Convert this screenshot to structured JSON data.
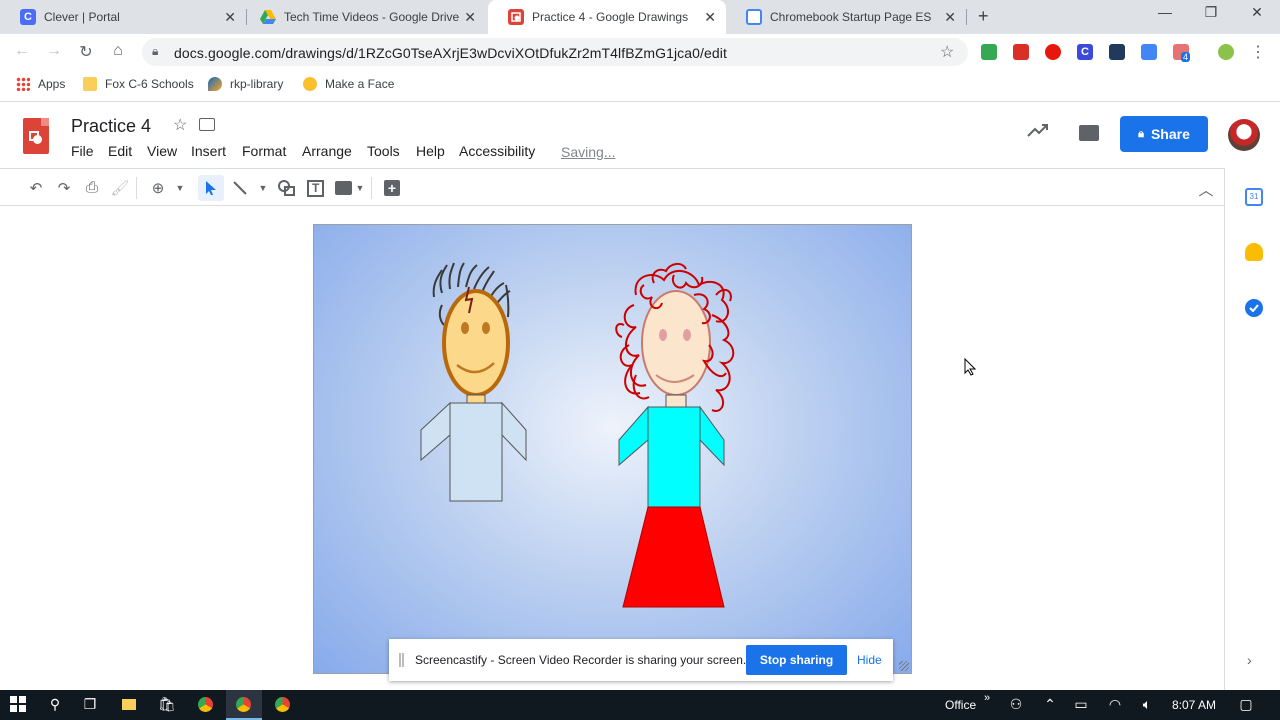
{
  "browser": {
    "tabs": [
      {
        "title": "Clever | Portal",
        "fav_color": "#4a6cf7",
        "fav_char": "C"
      },
      {
        "title": "Tech Time Videos - Google Drive",
        "fav_color": "#34a853",
        "fav_char": ""
      },
      {
        "title": "Practice 4 - Google Drawings",
        "fav_color": "#db4437",
        "fav_char": ""
      },
      {
        "title": "Chromebook Startup Page ES",
        "fav_color": "#4285f4",
        "fav_char": ""
      }
    ],
    "new_tab": "+",
    "url": "docs.google.com/drawings/d/1RZcG0TseAXrjE3wDcviXOtDfukZr2mT4lfBZmG1jca0/edit",
    "bookmarks": [
      "Apps",
      "Fox C-6 Schools",
      "rkp-library",
      "Make a Face"
    ],
    "extension_badge": "4"
  },
  "doc": {
    "title": "Practice 4",
    "menus": [
      "File",
      "Edit",
      "View",
      "Insert",
      "Format",
      "Arrange",
      "Tools",
      "Help",
      "Accessibility"
    ],
    "status": "Saving...",
    "share_label": "Share",
    "side_badge": "31"
  },
  "screencastify": {
    "message": "Screencastify - Screen Video Recorder is sharing your screen.",
    "stop_label": "Stop sharing",
    "hide_label": "Hide"
  },
  "taskbar": {
    "office_label": "Office",
    "time": "8:07 AM"
  },
  "colors": {
    "brand_blue": "#1a73e8",
    "drawings_red": "#db4437",
    "girl_shirt": "#00ffff",
    "girl_skirt": "#ff0000",
    "boy_shirt": "#cfe2f3"
  }
}
